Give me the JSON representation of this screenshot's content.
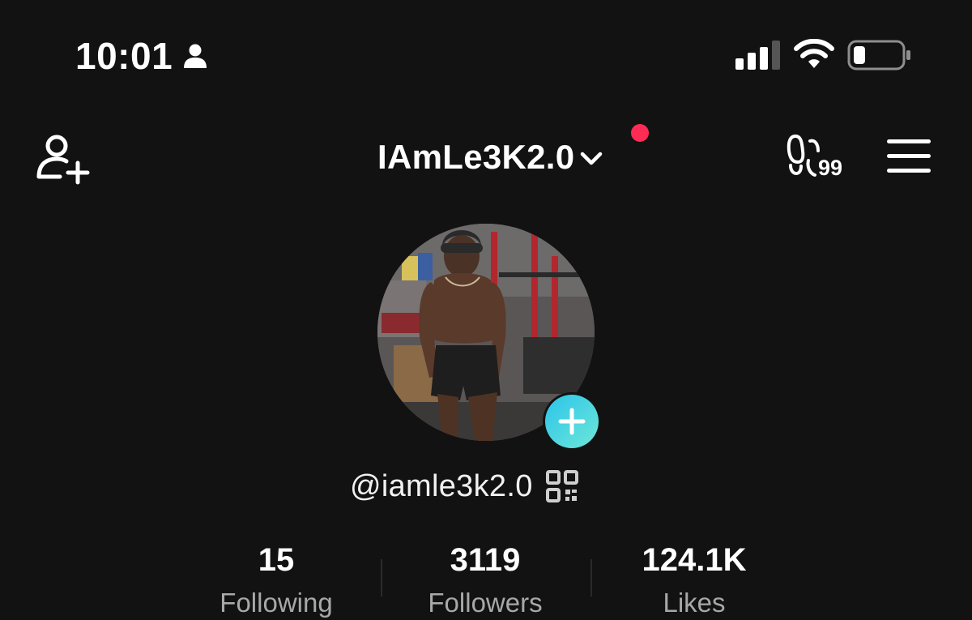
{
  "status_bar": {
    "time": "10:01",
    "icons": [
      "person-icon",
      "signal-icon",
      "wifi-icon",
      "battery-icon"
    ]
  },
  "header": {
    "account_name": "IAmLe3K2.0",
    "notification_dot_color": "#fe2c55",
    "footprints_count": "99",
    "icons": [
      "add-friend-icon",
      "chevron-down-icon",
      "footprints-icon",
      "menu-icon"
    ]
  },
  "profile": {
    "avatar_description": "profile photo",
    "add_button_gradient": [
      "#2bc4ea",
      "#6ee7d8"
    ],
    "handle": "@iamle3k2.0"
  },
  "stats": [
    {
      "value": "15",
      "label": "Following"
    },
    {
      "value": "3119",
      "label": "Followers"
    },
    {
      "value": "124.1K",
      "label": "Likes"
    }
  ],
  "colors": {
    "background": "#121212",
    "primary_text": "#ffffff",
    "secondary_text": "#a8a8a8"
  }
}
